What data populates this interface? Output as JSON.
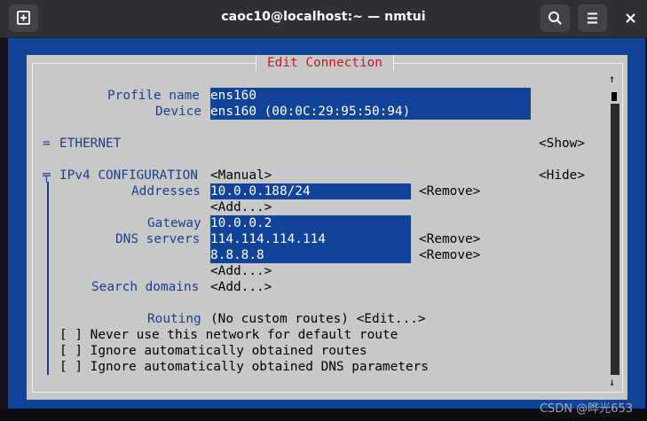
{
  "window": {
    "title": "caoc10@localhost:~ — nmtui"
  },
  "dialog": {
    "title": "Edit Connection",
    "profile_label": "Profile name",
    "profile_value": "ens160",
    "device_label": "Device",
    "device_value": "ens160 (00:0C:29:95:50:94)",
    "ethernet_marker": "=",
    "ethernet_label": "ETHERNET",
    "ethernet_toggle": "<Show>",
    "ipv4_marker": "╤",
    "ipv4_label": "IPv4 CONFIGURATION",
    "ipv4_method": "<Manual>",
    "ipv4_toggle": "<Hide>",
    "addresses_label": "Addresses",
    "address_value": "10.0.0.188/24",
    "remove_label": "<Remove>",
    "add_label": "<Add...>",
    "gateway_label": "Gateway",
    "gateway_value": "10.0.0.2",
    "dns_label": "DNS servers",
    "dns_servers": [
      "114.114.114.114",
      "8.8.8.8"
    ],
    "search_label": "Search domains",
    "routing_label": "Routing",
    "routing_value": "(No custom routes) <Edit...>",
    "checkbox_mark": "[ ]",
    "checkboxes": [
      "Never use this network for default route",
      "Ignore automatically obtained routes",
      "Ignore automatically obtained DNS parameters"
    ],
    "scroll_up": "↑",
    "scroll_down": "↓"
  },
  "watermark": "CSDN @晔光653",
  "icons": [
    "new-tab-icon",
    "search-icon",
    "menu-icon",
    "close-icon"
  ]
}
